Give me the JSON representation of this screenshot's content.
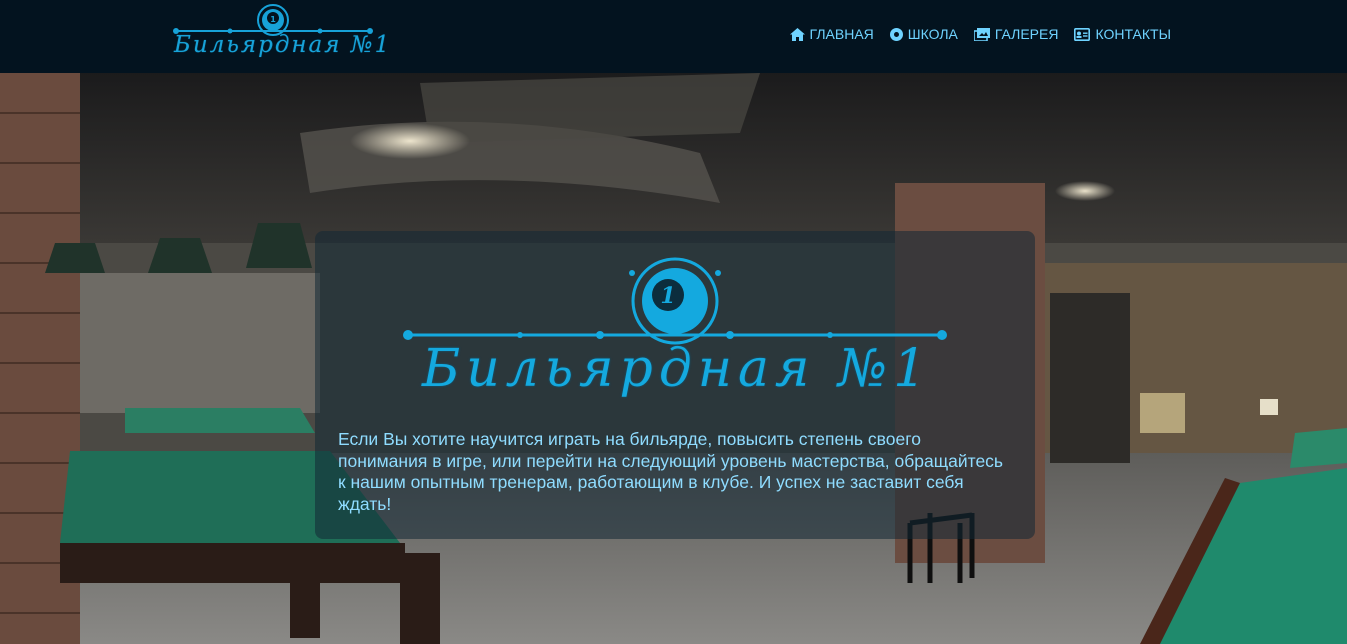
{
  "header": {
    "brand_text": "Бильярдная №1",
    "brand_number": "1",
    "nav": [
      {
        "label": "ГЛАВНАЯ",
        "icon": "home-icon"
      },
      {
        "label": "ШКОЛА",
        "icon": "dot-circle-icon"
      },
      {
        "label": "ГАЛЕРЕЯ",
        "icon": "images-icon"
      },
      {
        "label": "КОНТАКТЫ",
        "icon": "id-card-icon"
      }
    ]
  },
  "hero": {
    "logo_text": "Бильярдная №1",
    "logo_number": "1",
    "description": "Если Вы хотите научится играть на бильярде, повысить степень своего понимания в игре, или перейти на следующий уровень мастерства, обращайтесь к нашим опытным тренерам, работающим в клубе. И успех не заставит себя ждать!"
  },
  "colors": {
    "header_bg": "#03131f",
    "accent": "#14a9df",
    "nav_text": "#6fd3ff",
    "card_text": "#8fdcff"
  }
}
